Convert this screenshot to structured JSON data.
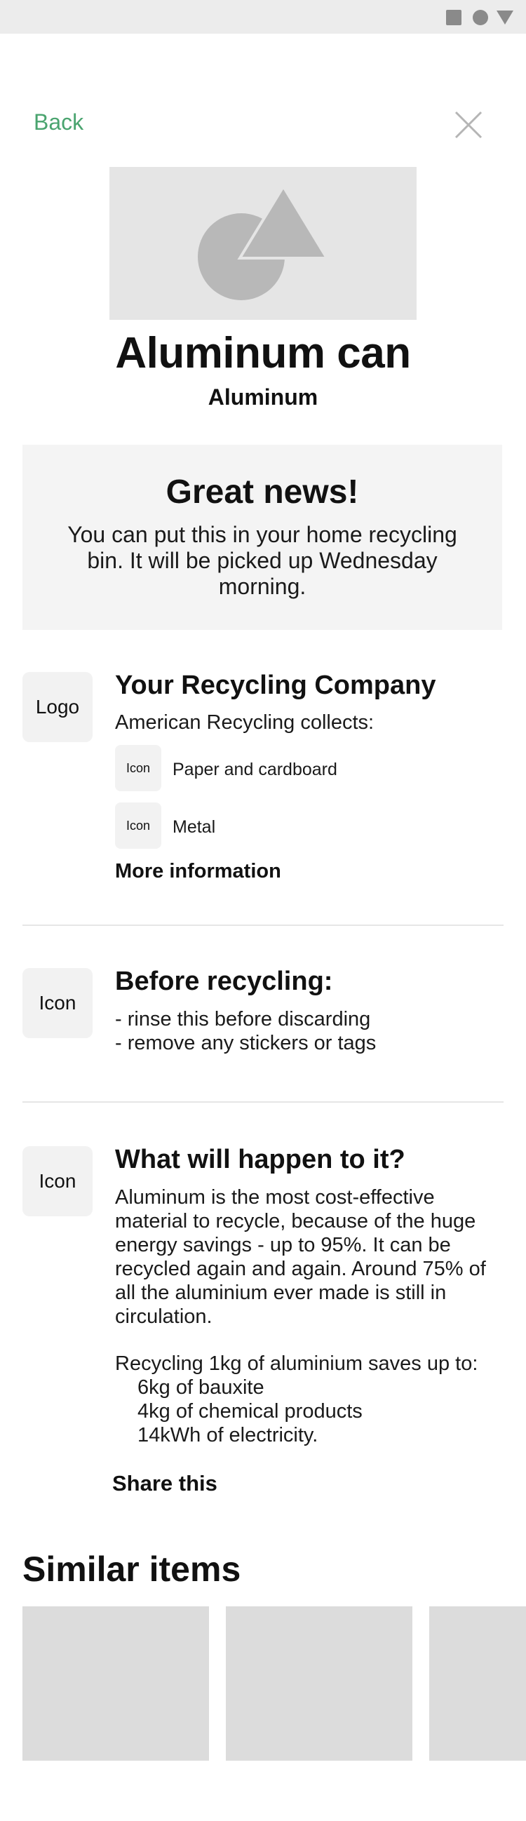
{
  "header": {
    "back_label": "Back"
  },
  "item": {
    "title": "Aluminum can",
    "material": "Aluminum"
  },
  "news": {
    "title": "Great news!",
    "text": "You can put this in your home recycling bin. It will be picked up Wednesday morning."
  },
  "company": {
    "logo_label": "Logo",
    "heading": "Your Recycling Company",
    "collects_text": "American Recycling collects:",
    "items": [
      {
        "icon_label": "Icon",
        "label": "Paper and cardboard"
      },
      {
        "icon_label": "Icon",
        "label": "Metal"
      }
    ],
    "more_info_label": "More information"
  },
  "before": {
    "icon_label": "Icon",
    "heading": "Before recycling:",
    "lines": [
      "- rinse this before discarding",
      "- remove any stickers or tags"
    ]
  },
  "happen": {
    "icon_label": "Icon",
    "heading": "What will happen to it?",
    "paragraph": "Aluminum is the most cost-effective material to recycle, because of the huge energy savings - up to 95%. It can be recycled again and again. Around 75% of all the aluminium ever made is still in circulation.",
    "savings_intro": "Recycling 1kg of aluminium saves up to:",
    "savings": [
      "6kg of bauxite",
      "4kg of chemical products",
      "14kWh of electricity."
    ],
    "share_label": "Share this"
  },
  "similar": {
    "heading": "Similar items"
  },
  "colors": {
    "accent": "#4aa46f",
    "placeholder": "#dcdcdc",
    "panel": "#f4f4f4"
  },
  "icons": [
    "square-icon",
    "circle-icon",
    "triangle-icon",
    "close-icon",
    "image-placeholder-icon"
  ]
}
